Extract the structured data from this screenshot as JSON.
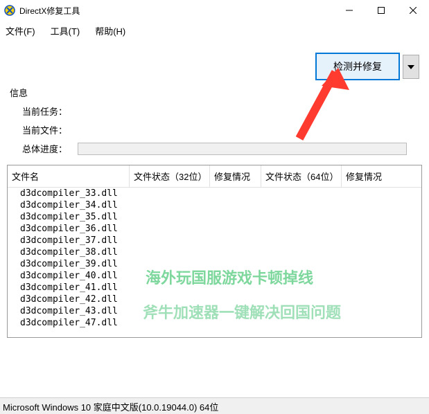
{
  "titlebar": {
    "title": "DirectX修复工具"
  },
  "menu": {
    "file": "文件(F)",
    "tools": "工具(T)",
    "help": "帮助(H)"
  },
  "toolbar": {
    "main_btn": "检测并修复"
  },
  "info": {
    "heading": "信息",
    "task_label": "当前任务：",
    "file_label": "当前文件：",
    "progress_label": "总体进度："
  },
  "table": {
    "headers": {
      "name": "文件名",
      "status32": "文件状态（32位）",
      "fix1": "修复情况",
      "status64": "文件状态（64位）",
      "fix2": "修复情况"
    },
    "rows": [
      "d3dcompiler_33.dll",
      "d3dcompiler_34.dll",
      "d3dcompiler_35.dll",
      "d3dcompiler_36.dll",
      "d3dcompiler_37.dll",
      "d3dcompiler_38.dll",
      "d3dcompiler_39.dll",
      "d3dcompiler_40.dll",
      "d3dcompiler_41.dll",
      "d3dcompiler_42.dll",
      "d3dcompiler_43.dll",
      "d3dcompiler_47.dll"
    ]
  },
  "statusbar": {
    "text": "Microsoft Windows 10 家庭中文版(10.0.19044.0) 64位"
  },
  "overlay": {
    "line1": "海外玩国服游戏卡顿掉线",
    "line2": "斧牛加速器一键解决回国问题"
  }
}
